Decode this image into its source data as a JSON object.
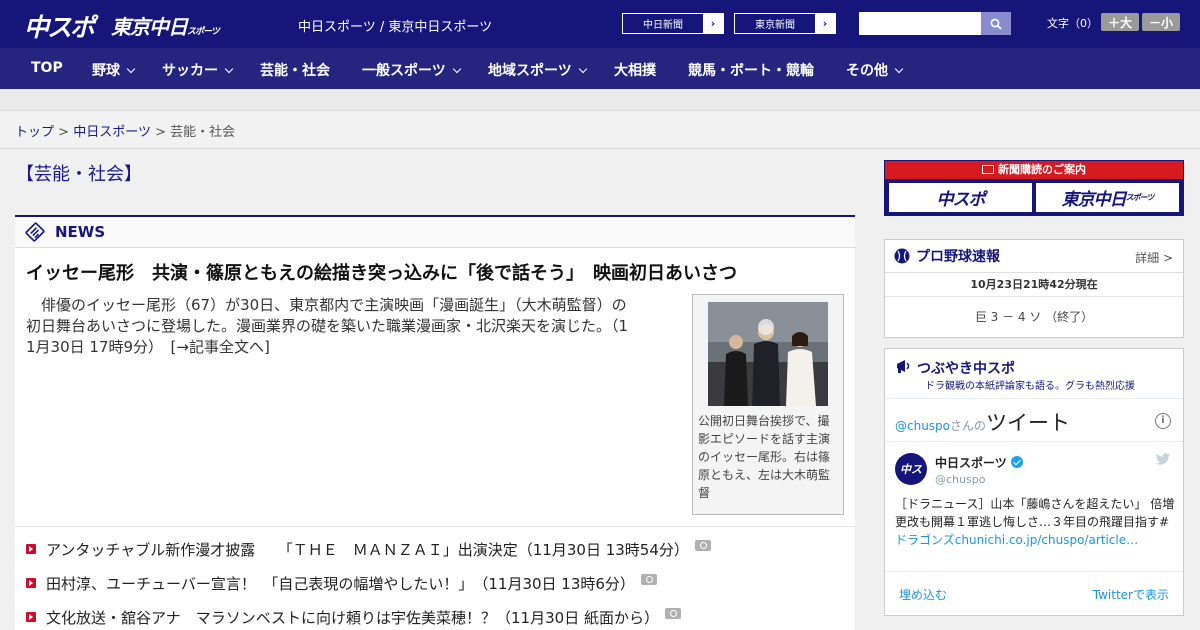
{
  "header": {
    "logo_main": "中スポ",
    "logo_tokyo": "東京中日",
    "logo_tokyo_small": "スポーツ",
    "site_name": "中日スポーツ / 東京中日スポーツ",
    "ext_links": [
      {
        "label": "中日新聞",
        "arrow": "›"
      },
      {
        "label": "東京新聞",
        "arrow": "›"
      }
    ],
    "search_placeholder": "",
    "font_size_label": "文字（0）",
    "font_bigger": "＋大",
    "font_smaller": "－小"
  },
  "nav": {
    "items": [
      {
        "label": "TOP",
        "dropdown": false
      },
      {
        "label": "野球",
        "dropdown": true
      },
      {
        "label": "サッカー",
        "dropdown": true
      },
      {
        "label": "芸能・社会",
        "dropdown": false
      },
      {
        "label": "一般スポーツ",
        "dropdown": true
      },
      {
        "label": "地域スポーツ",
        "dropdown": true
      },
      {
        "label": "大相撲",
        "dropdown": false
      },
      {
        "label": "競馬・ボート・競輪",
        "dropdown": false
      },
      {
        "label": "その他",
        "dropdown": true
      }
    ]
  },
  "breadcrumb": {
    "items": [
      "トップ",
      "中日スポーツ",
      "芸能・社会"
    ],
    "separator": ">"
  },
  "page": {
    "title": "【芸能・社会】"
  },
  "news": {
    "section_label": "NEWS",
    "headline": "イッセー尾形　共演・篠原ともえの絵描き突っ込みに「後で話そう」　映画初日あいさつ",
    "lead_lines": [
      "　俳優のイッセー尾形（67）が30日、東京都内で主演映画「漫画誕生」（大木萌監督）の",
      "初日舞台あいさつに登場した。漫画業界の礎を築いた職業漫画家・北沢楽天を演じた。（1",
      "1月30日 17時9分）　[→記事全文へ]"
    ],
    "photo_caption_lines": [
      "公開初日舞台挨拶で、撮",
      "影エピソードを話す主演",
      "のイッセー尾形。右は篠",
      "原ともえ、左は大木萌監",
      "督"
    ],
    "list": [
      {
        "title": "アンタッチャブル新作漫才披露　　「ＴＨＥ　ＭＡＮＺＡＩ」出演決定",
        "time": "（11月30日 13時54分）",
        "has_photo": true
      },
      {
        "title": "田村淳、ユーチューバー宣言！　「自己表現の幅増やしたい！」",
        "time": "（11月30日 13時6分）",
        "has_photo": true
      },
      {
        "title": "文化放送・舘谷アナ　マラソンベストに向け頼りは宇佐美菜穂！？",
        "time": "（11月30日 紙面から）",
        "has_photo": true
      }
    ]
  },
  "subscribe": {
    "header": "新聞購読のご案内",
    "logo_main": "中スポ",
    "logo_tokyo": "東京中日",
    "logo_tokyo_small": "スポーツ"
  },
  "baseball": {
    "title": "プロ野球速報",
    "more": "詳細 >",
    "updated": "10月23日21時42分現在",
    "score": "巨 3 － 4 ソ （終了）"
  },
  "twitter": {
    "title": "つぶやき中スポ",
    "subtitle": "ドラ観戦の本紙評論家も語る。グラも熱烈応援",
    "handle_link": "@chuspo",
    "handle_suffix": "さんの",
    "tweets_label": "ツイート",
    "info": "i",
    "avatar_text": "中ス",
    "account_name": "中日スポーツ",
    "account_handle": "@chuspo",
    "tweet_lines": [
      "［ドラニュース］山本「藤嶋さんを超えたい」 倍増",
      "更改も開幕１軍逃し悔しさ…３年目の飛躍目指す#"
    ],
    "tweet_link": "ドラゴンズchunichi.co.jp/chuspo/article…",
    "embed": "埋め込む",
    "view_on_twitter": "Twitterで表示"
  }
}
